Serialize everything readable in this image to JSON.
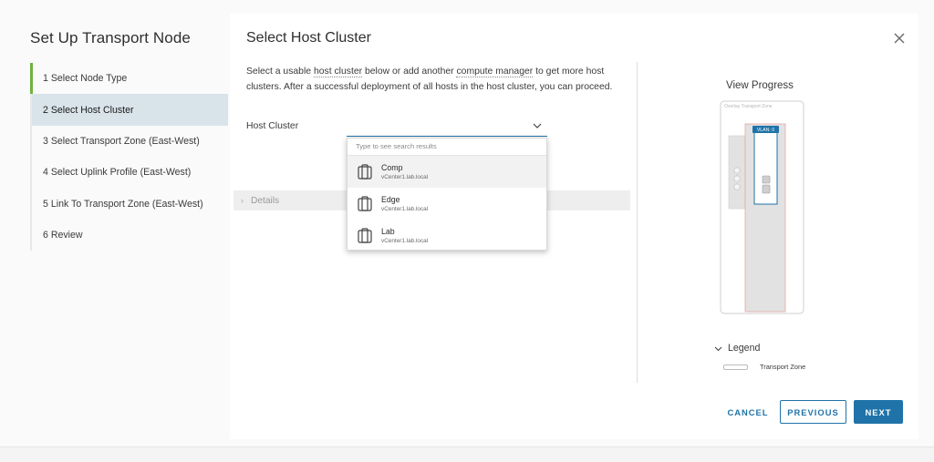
{
  "wizard": {
    "title": "Set Up Transport Node",
    "steps": [
      {
        "label": "1   Select Node Type"
      },
      {
        "label": "2   Select Host Cluster"
      },
      {
        "label": "3   Select Transport Zone (East-West)"
      },
      {
        "label": "4   Select Uplink Profile (East-West)"
      },
      {
        "label": "5   Link To Transport Zone (East-West)"
      },
      {
        "label": "6   Review"
      }
    ]
  },
  "page": {
    "title": "Select Host Cluster",
    "desc_a": "Select a usable ",
    "desc_link1": "host cluster",
    "desc_b": " below or add another ",
    "desc_link2": "compute manager",
    "desc_c": " to get more host clusters. After a successful deployment of all hosts in the host cluster, you can proceed.",
    "field_label": "Host Cluster",
    "details_label": "Details"
  },
  "dropdown": {
    "placeholder": "Type to see search results",
    "items": [
      {
        "name": "Comp",
        "sub": "vCenter1.lab.local"
      },
      {
        "name": "Edge",
        "sub": "vCenter1.lab.local"
      },
      {
        "name": "Lab",
        "sub": "vCenter1.lab.local"
      }
    ]
  },
  "progress": {
    "title": "View Progress",
    "zone_label": "Overlay Transport Zone",
    "vlan_badge": "VLAN: 0",
    "legend_title": "Legend",
    "legend_item": "Transport Zone"
  },
  "buttons": {
    "cancel": "CANCEL",
    "previous": "PREVIOUS",
    "next": "NEXT"
  },
  "colors": {
    "accent": "#1f73a8",
    "completed_step": "#6db33f",
    "active_step_bg": "#d9e4ea"
  }
}
